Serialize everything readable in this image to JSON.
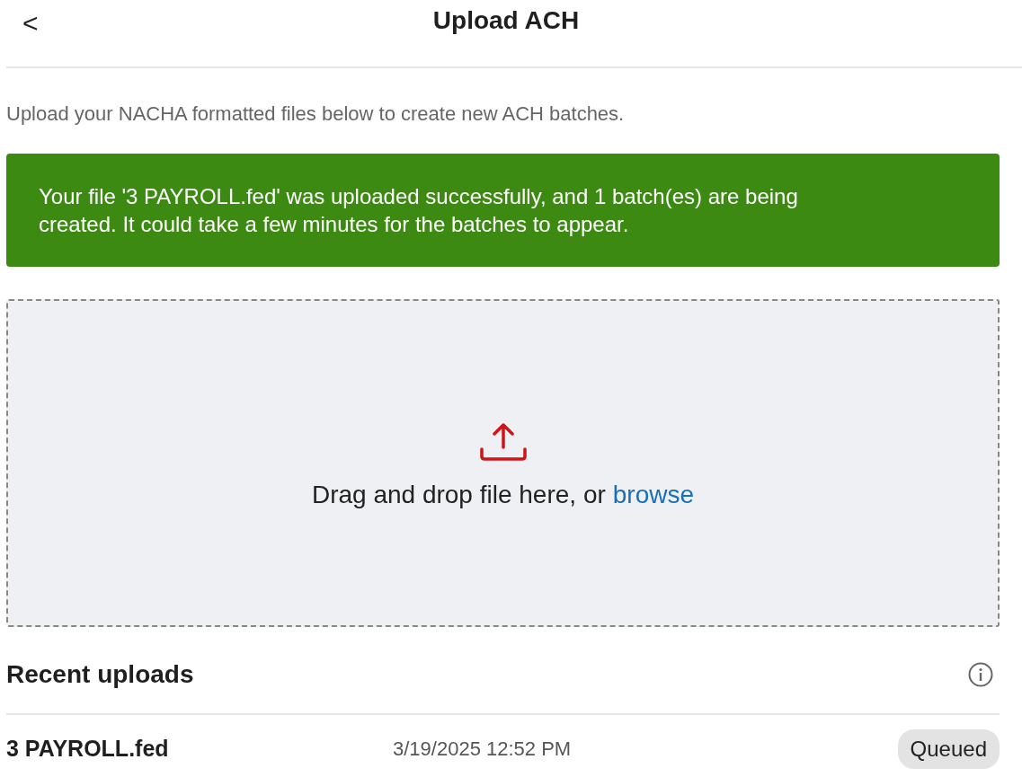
{
  "header": {
    "back": "<",
    "title": "Upload ACH"
  },
  "intro": "Upload your NACHA formatted files below to create new ACH batches.",
  "alert": {
    "kind": "success",
    "text": "Your file '3 PAYROLL.fed' was uploaded successfully, and 1 batch(es) are being created. It could take a few minutes for the batches to appear."
  },
  "dropzone": {
    "prompt": "Drag and drop file here, or",
    "link": "browse"
  },
  "recent": {
    "title": "Recent uploads",
    "rows": [
      {
        "name": "3 PAYROLL.fed",
        "date": "3/19/2025 12:52 PM",
        "status": "Queued"
      }
    ]
  }
}
